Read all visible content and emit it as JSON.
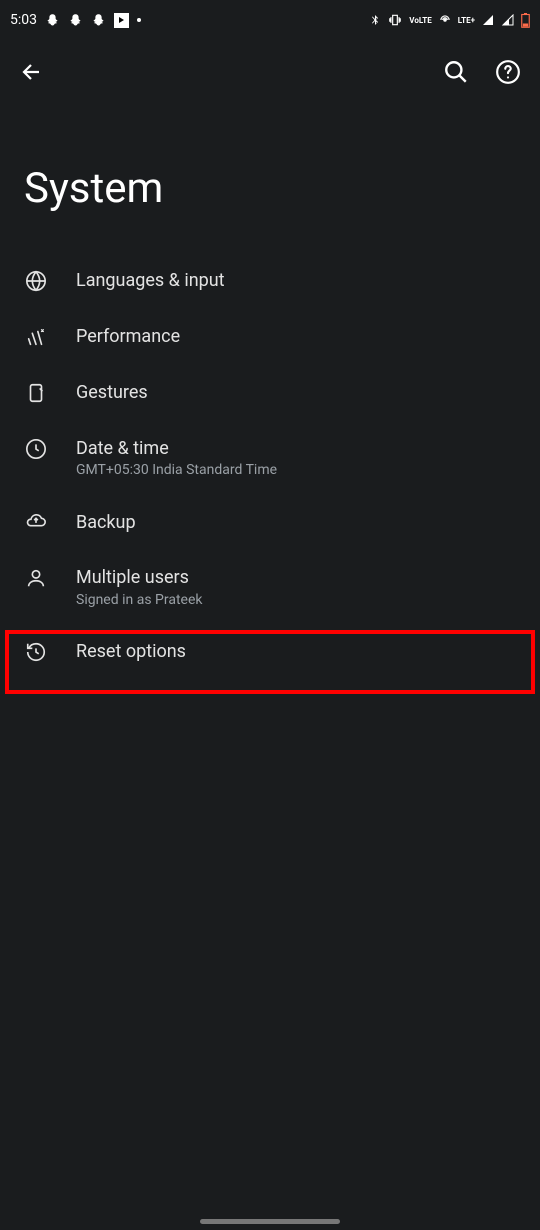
{
  "status_bar": {
    "time": "5:03",
    "lte_label": "LTE+",
    "volte_label": "VoLTE"
  },
  "page": {
    "title": "System"
  },
  "items": [
    {
      "title": "Languages & input",
      "subtitle": "",
      "icon": "globe"
    },
    {
      "title": "Performance",
      "subtitle": "",
      "icon": "performance"
    },
    {
      "title": "Gestures",
      "subtitle": "",
      "icon": "gestures"
    },
    {
      "title": "Date & time",
      "subtitle": "GMT+05:30 India Standard Time",
      "icon": "clock"
    },
    {
      "title": "Backup",
      "subtitle": "",
      "icon": "cloud-upload"
    },
    {
      "title": "Multiple users",
      "subtitle": "Signed in as Prateek",
      "icon": "person"
    },
    {
      "title": "Reset options",
      "subtitle": "",
      "icon": "history"
    }
  ]
}
